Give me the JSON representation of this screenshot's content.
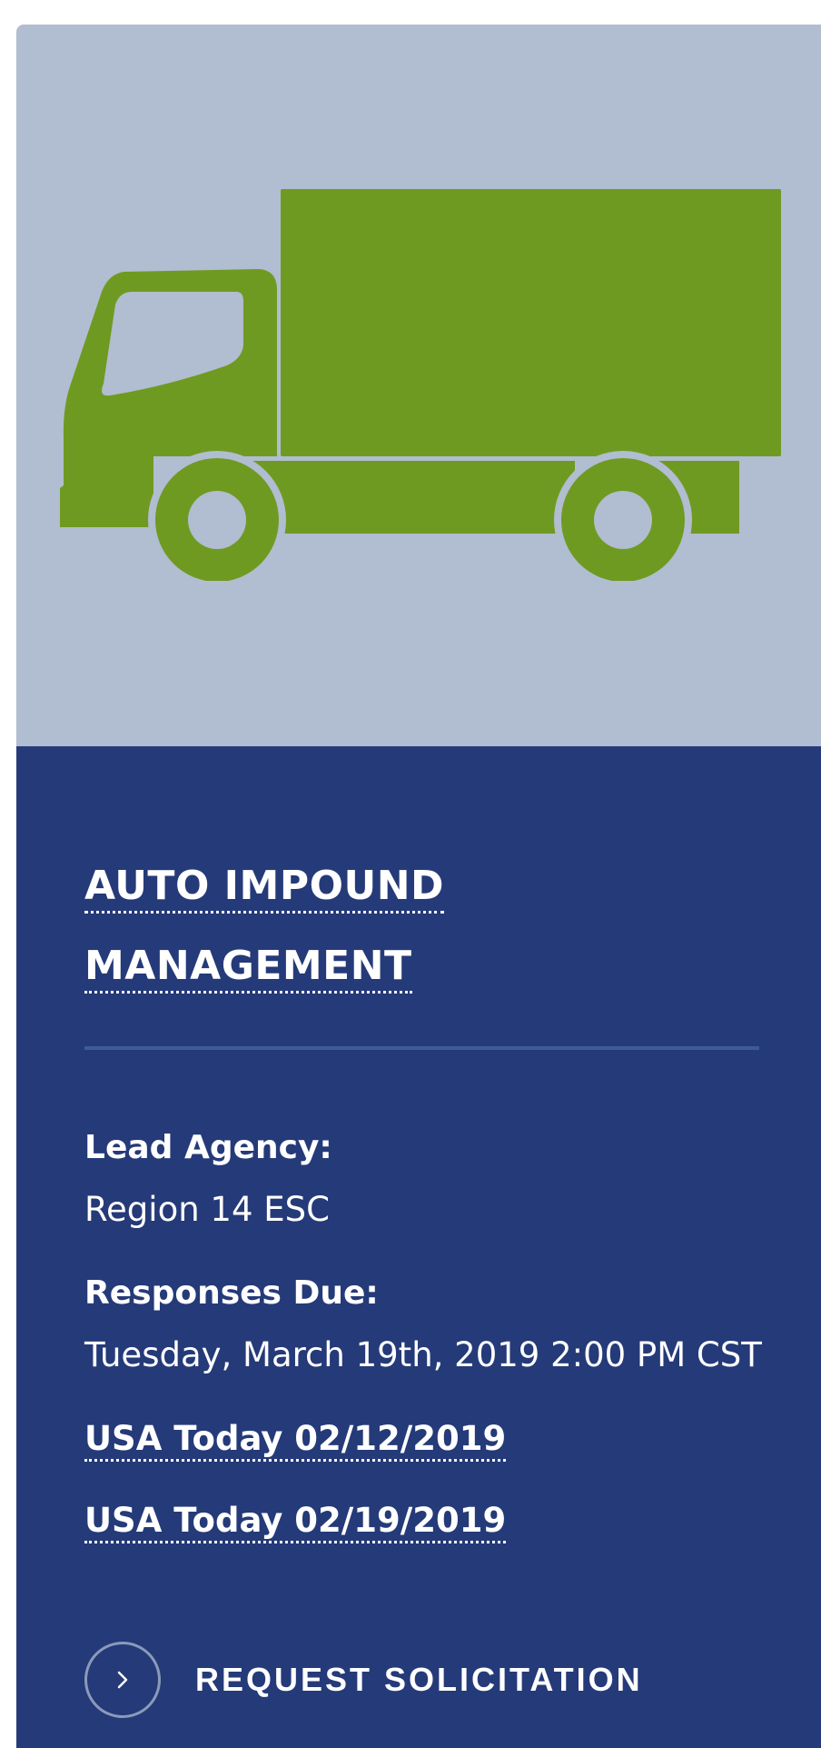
{
  "card": {
    "image_icon": "box-truck-icon",
    "colors": {
      "hero_background": "#b1bdd0",
      "truck": "#6f9a21",
      "panel_background": "#253a78",
      "divider": "#3d5c95"
    },
    "title_line1": "AUTO IMPOUND",
    "title_line2": "MANAGEMENT",
    "lead_agency_label": "Lead Agency:",
    "lead_agency_value": "Region 14 ESC",
    "responses_due_label": "Responses Due:",
    "responses_due_value": "Tuesday, March 19th, 2019 2:00 PM CST",
    "links": [
      "USA Today 02/12/2019",
      "USA Today 02/19/2019"
    ],
    "cta_icon": "chevron-right-icon",
    "cta_label": "REQUEST SOLICITATION"
  }
}
